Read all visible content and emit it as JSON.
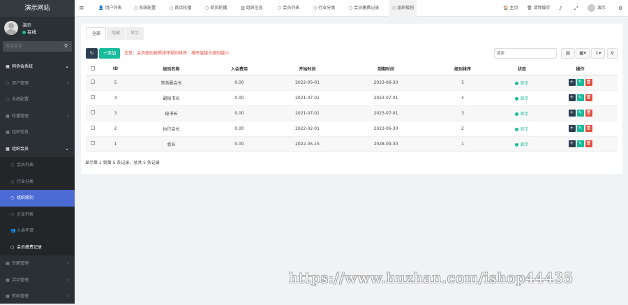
{
  "sidebar": {
    "logo": "演示网站",
    "user": {
      "name": "演示",
      "status": "在线"
    },
    "search_placeholder": "搜索菜单",
    "menu": [
      {
        "label": "同协会系统",
        "icon": "▦",
        "type": "head",
        "arrow": "⌄"
      },
      {
        "label": "用户管理",
        "icon": "○",
        "type": "normal",
        "arrow": "‹"
      },
      {
        "label": "系统配置",
        "icon": "○",
        "type": "normal",
        "arrow": ""
      },
      {
        "label": "轮播管理",
        "icon": "▦",
        "type": "normal",
        "arrow": "‹"
      },
      {
        "label": "组织信息",
        "icon": "▦",
        "type": "normal",
        "arrow": ""
      },
      {
        "label": "组织会员",
        "icon": "▦",
        "type": "head",
        "arrow": "⌄"
      },
      {
        "label": "会员列表",
        "icon": "○",
        "type": "sub",
        "arrow": ""
      },
      {
        "label": "行业分类",
        "icon": "○",
        "type": "sub",
        "arrow": ""
      },
      {
        "label": "组织级别",
        "icon": "○",
        "type": "sub-active",
        "arrow": ""
      },
      {
        "label": "企业列表",
        "icon": "○",
        "type": "sub",
        "arrow": ""
      },
      {
        "label": "入会申请",
        "icon": "👥",
        "type": "sub",
        "arrow": ""
      },
      {
        "label": "会员缴费记录",
        "icon": "○",
        "type": "sub-hl",
        "arrow": ""
      },
      {
        "label": "页面管理",
        "icon": "▦",
        "type": "normal",
        "arrow": "‹"
      },
      {
        "label": "活动管理",
        "icon": "▦",
        "type": "normal",
        "arrow": "‹"
      },
      {
        "label": "新闻管理",
        "icon": "▦",
        "type": "normal",
        "arrow": "‹"
      }
    ]
  },
  "topbar": {
    "menu_icon": "≡",
    "tabs": [
      {
        "label": "用户列表",
        "icon": "👤"
      },
      {
        "label": "系统配置",
        "icon": "○"
      },
      {
        "label": "首页轮播",
        "icon": "○"
      },
      {
        "label": "首页轮播",
        "icon": "○"
      },
      {
        "label": "组织信息",
        "icon": "▥"
      },
      {
        "label": "会员列表",
        "icon": "○"
      },
      {
        "label": "行业分类",
        "icon": "○"
      },
      {
        "label": "会员缴费记录",
        "icon": "○"
      },
      {
        "label": "组织级别",
        "icon": "○"
      }
    ],
    "right": {
      "home": "主页",
      "clear": "清除缓存",
      "user": "演示"
    }
  },
  "content": {
    "tabs": [
      "全部",
      "隐藏",
      "显示"
    ],
    "add_label": "添加",
    "notice": "注意：会员级别按照排序规则排序，排序值越大级别越小",
    "search_placeholder": "搜索",
    "columns": [
      "ID",
      "级别名称",
      "入会费用",
      "开始时间",
      "到期时间",
      "级别排序",
      "状态",
      "操作"
    ],
    "rows": [
      {
        "id": "5",
        "name": "常务副会长",
        "fee": "0.00",
        "start": "2022-05-01",
        "end": "2023-06-30",
        "sort": "5",
        "status": "显示"
      },
      {
        "id": "4",
        "name": "副秘书长",
        "fee": "0.00",
        "start": "2021-07-01",
        "end": "2023-07-01",
        "sort": "4",
        "status": "显示"
      },
      {
        "id": "3",
        "name": "秘书长",
        "fee": "0.00",
        "start": "2021-07-01",
        "end": "2023-07-01",
        "sort": "3",
        "status": "显示"
      },
      {
        "id": "2",
        "name": "执行会长",
        "fee": "0.00",
        "start": "2022-02-01",
        "end": "2023-06-30",
        "sort": "2",
        "status": "显示"
      },
      {
        "id": "1",
        "name": "会长",
        "fee": "0.00",
        "start": "2022-05-15",
        "end": "2028-09-30",
        "sort": "1",
        "status": "显示"
      }
    ],
    "pagination": "显示第 1 到第 5 条记录，总共 5 条记录"
  },
  "watermark": "https://www.huzhan.com/ishop44435",
  "colors": {
    "sidebar": "#2b3035",
    "active": "#4c6bd4",
    "success": "#18bc9c",
    "danger": "#e74c3c",
    "dark": "#2c3e50"
  }
}
